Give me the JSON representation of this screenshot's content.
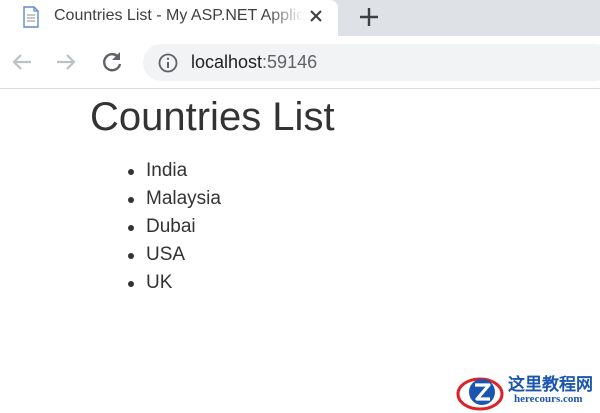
{
  "browser": {
    "tab": {
      "title": "Countries List - My ASP.NET Application",
      "favicon": "document-icon"
    },
    "address_bar": {
      "host": "localhost",
      "port": ":59146"
    }
  },
  "page": {
    "heading": "Countries List",
    "countries": [
      "India",
      "Malaysia",
      "Dubai",
      "USA",
      "UK"
    ]
  },
  "watermark": {
    "title_cn": "这里教程网",
    "site": "herecours.com"
  },
  "colors": {
    "tabstrip": "#dee1e6",
    "text": "#333333",
    "watermark_blue": "#1a56b0",
    "watermark_red": "#d9242a"
  }
}
